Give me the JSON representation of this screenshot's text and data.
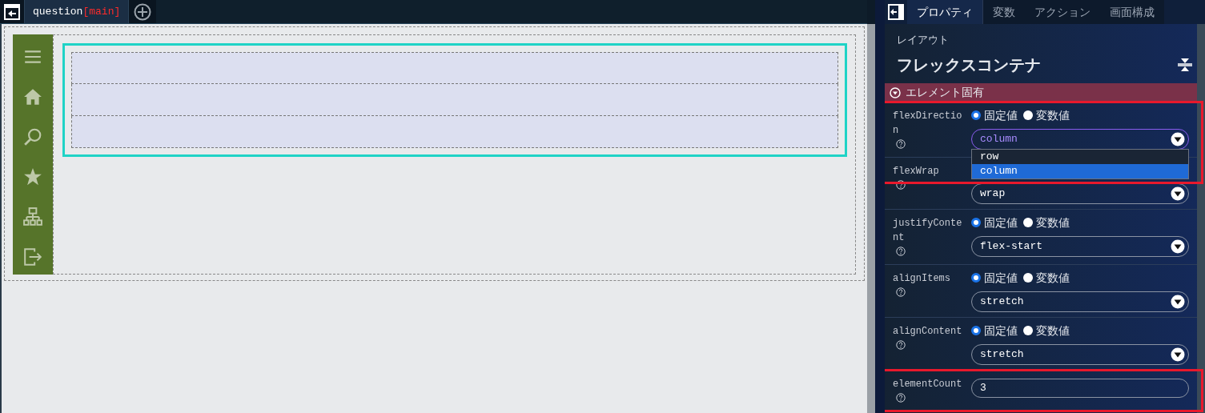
{
  "editor_tabs": [
    {
      "name": "question",
      "branch": "[main]",
      "selected": true
    }
  ],
  "sidebar": {
    "items": [
      {
        "kind": "menu"
      },
      {
        "kind": "home"
      },
      {
        "kind": "search"
      },
      {
        "kind": "star"
      },
      {
        "kind": "sitemap"
      },
      {
        "kind": "logout"
      }
    ]
  },
  "canvas": {
    "flex_items": [
      {
        "kind": "empty"
      },
      {
        "kind": "empty"
      },
      {
        "kind": "empty"
      }
    ]
  },
  "panel": {
    "tabs": [
      {
        "label": "プロパティ",
        "selected": true
      },
      {
        "label": "変数",
        "selected": false
      },
      {
        "label": "アクション",
        "selected": false
      },
      {
        "label": "画面構成",
        "selected": false
      }
    ],
    "category": "レイアウト",
    "title": "フレックスコンテナ",
    "section": {
      "label": "エレメント固有",
      "expanded": true
    },
    "properties": [
      {
        "kind": "select",
        "label": "flexDirection",
        "highlighted": true,
        "modes": [
          {
            "label": "固定値",
            "selected": true
          },
          {
            "label": "変数値",
            "selected": false
          }
        ],
        "value": "column",
        "focused": true,
        "options": [
          {
            "label": "row",
            "selected": false
          },
          {
            "label": "column",
            "selected": true
          }
        ]
      },
      {
        "kind": "select",
        "label": "flexWrap",
        "highlighted": false,
        "value": "wrap",
        "focused": false
      },
      {
        "kind": "select",
        "label": "justifyContent",
        "highlighted": false,
        "modes": [
          {
            "label": "固定値",
            "selected": true
          },
          {
            "label": "変数値",
            "selected": false
          }
        ],
        "value": "flex-start",
        "focused": false
      },
      {
        "kind": "select",
        "label": "alignItems",
        "highlighted": false,
        "modes": [
          {
            "label": "固定値",
            "selected": true
          },
          {
            "label": "変数値",
            "selected": false
          }
        ],
        "value": "stretch",
        "focused": false
      },
      {
        "kind": "select",
        "label": "alignContent",
        "highlighted": false,
        "modes": [
          {
            "label": "固定値",
            "selected": true
          },
          {
            "label": "変数値",
            "selected": false
          }
        ],
        "value": "stretch",
        "focused": false
      },
      {
        "kind": "input",
        "label": "elementCount",
        "highlighted": true,
        "value": "3"
      }
    ]
  }
}
